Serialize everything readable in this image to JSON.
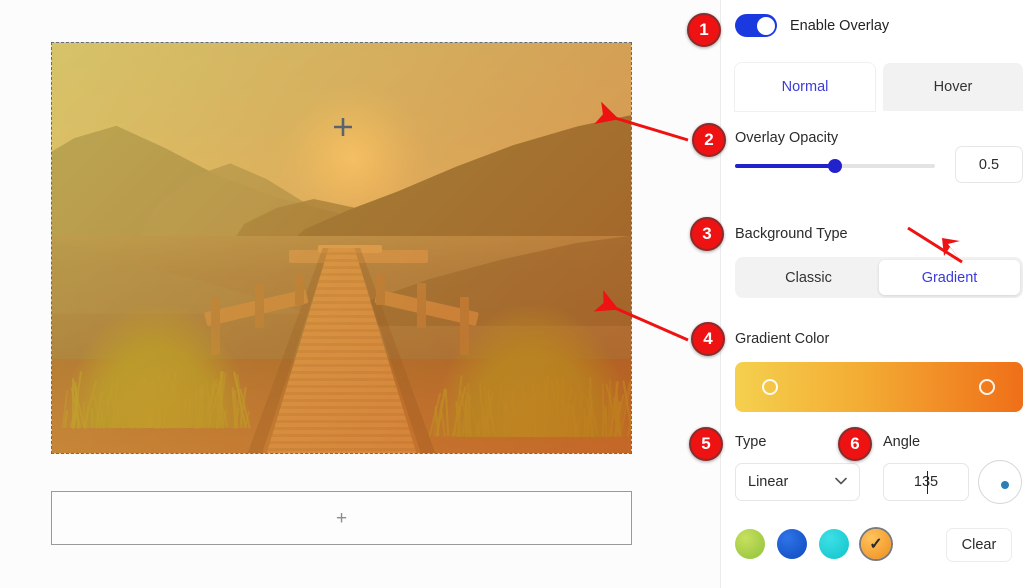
{
  "app": {
    "background": "#fdfdfd",
    "accent_blue": "#3b3bdb",
    "annotation_red": "#ee1212"
  },
  "canvas": {
    "image": {
      "name": "lake-dock-sunset-photo",
      "description": "Lake with wooden dock, mountains and sun, gradient overlay applied",
      "plus_cursor": "+"
    },
    "add_placeholder": {
      "plus": "+"
    }
  },
  "panel": {
    "enable_overlay": {
      "label": "Enable Overlay",
      "enabled": true
    },
    "tabs": [
      {
        "label": "Normal",
        "active": true
      },
      {
        "label": "Hover",
        "active": false
      }
    ],
    "overlay_opacity": {
      "label": "Overlay Opacity",
      "value": "0.5",
      "fill_percent": 50
    },
    "background_type": {
      "label": "Background Type",
      "options": [
        {
          "label": "Classic",
          "selected": false
        },
        {
          "label": "Gradient",
          "selected": true
        }
      ]
    },
    "gradient_color": {
      "label": "Gradient Color",
      "start_color": "#f5d04e",
      "end_color": "#ef6f18",
      "stops": [
        "#f5d04e",
        "#ef6f18"
      ]
    },
    "type": {
      "label": "Type",
      "value": "Linear",
      "caret": "chevron-down"
    },
    "angle": {
      "label": "Angle",
      "value": "135"
    },
    "swatches": [
      {
        "color": "#a8d14a",
        "selected": false
      },
      {
        "color": "#1a5fd6",
        "selected": false
      },
      {
        "color": "#21d0d8",
        "selected": false
      },
      {
        "color": "#f5a32a",
        "selected": true,
        "check": "✓"
      }
    ],
    "clear_button": {
      "label": "Clear"
    }
  },
  "annotations": {
    "badges": [
      {
        "number": "1"
      },
      {
        "number": "2"
      },
      {
        "number": "3"
      },
      {
        "number": "4"
      },
      {
        "number": "5"
      },
      {
        "number": "6"
      }
    ]
  }
}
